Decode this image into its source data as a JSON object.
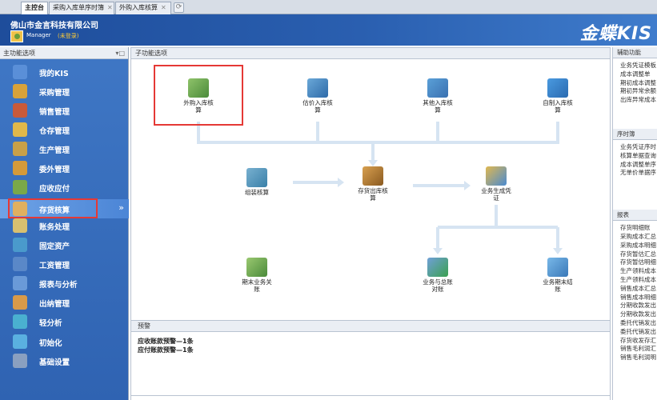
{
  "tabs": [
    {
      "label": "主控台",
      "closable": false,
      "active": true
    },
    {
      "label": "采购入库单序时簿",
      "closable": true,
      "active": false
    },
    {
      "label": "外购入库核算",
      "closable": true,
      "active": false
    }
  ],
  "tab_add_icon": "⟳",
  "header": {
    "company": "佛山市金言科技有限公司",
    "user": "Manager",
    "user_status": "(未登录)",
    "brand": "金蝶KIS"
  },
  "sidebar": {
    "title": "主功能选项",
    "pin": "▾□",
    "items": [
      {
        "label": "我的KIS",
        "icon": "my-kis-icon",
        "color": "#5a8fd8"
      },
      {
        "label": "采购管理",
        "icon": "purchase-icon",
        "color": "#d8a23a"
      },
      {
        "label": "销售管理",
        "icon": "sales-icon",
        "color": "#c85a3a"
      },
      {
        "label": "仓存管理",
        "icon": "warehouse-icon",
        "color": "#e0b84a"
      },
      {
        "label": "生产管理",
        "icon": "production-icon",
        "color": "#c8a048"
      },
      {
        "label": "委外管理",
        "icon": "outsource-icon",
        "color": "#d49a3a"
      },
      {
        "label": "应收应付",
        "icon": "receivable-icon",
        "color": "#7aa848"
      },
      {
        "label": "存货核算",
        "icon": "inventory-icon",
        "color": "#e0b060"
      },
      {
        "label": "账务处理",
        "icon": "accounting-icon",
        "color": "#d8c070"
      },
      {
        "label": "固定资产",
        "icon": "asset-icon",
        "color": "#4a9acc"
      },
      {
        "label": "工资管理",
        "icon": "salary-icon",
        "color": "#5a88c8"
      },
      {
        "label": "报表与分析",
        "icon": "report-icon",
        "color": "#6a9ad8"
      },
      {
        "label": "出纳管理",
        "icon": "cashier-icon",
        "color": "#d89a4a"
      },
      {
        "label": "轻分析",
        "icon": "analysis-icon",
        "color": "#4ab0d0"
      },
      {
        "label": "初始化",
        "icon": "init-icon",
        "color": "#5ab0e0"
      },
      {
        "label": "基础设置",
        "icon": "settings-icon",
        "color": "#8aa0c0"
      }
    ],
    "selected_index": 7,
    "selected_arrow": "»"
  },
  "main": {
    "title": "子功能选项",
    "nodes": [
      {
        "id": "purchase-in",
        "label": "外购入库核\n算"
      },
      {
        "id": "estimate-in",
        "label": "估价入库核\n算"
      },
      {
        "id": "other-in",
        "label": "其他入库核\n算"
      },
      {
        "id": "self-made-in",
        "label": "自制入库核\n算"
      },
      {
        "id": "assembly",
        "label": "组装核算"
      },
      {
        "id": "outbound",
        "label": "存货出库核\n算"
      },
      {
        "id": "gen-voucher",
        "label": "业务生成凭\n证"
      },
      {
        "id": "period-end",
        "label": "期末业务关\n账"
      },
      {
        "id": "reconcile",
        "label": "业务与总账\n对账"
      },
      {
        "id": "period-close",
        "label": "业务期末结\n账"
      }
    ]
  },
  "alerts": {
    "title": "预警",
    "lines": [
      "应收账款预警—1条",
      "应付账款预警—1条"
    ]
  },
  "right_panel": {
    "sections": [
      {
        "title": "辅助功能",
        "items": [
          "业务凭证模板",
          "成本调整单",
          "期初成本调整",
          "期初异常余额",
          "出库异常成本"
        ]
      },
      {
        "title": "序时簿",
        "items": [
          "业务凭证序时",
          "核算单据查询",
          "成本调整单序",
          "无单价单据序"
        ]
      },
      {
        "title": "报表",
        "items": [
          "存货明细账",
          "采购成本汇总",
          "采购成本明细",
          "存货暂估汇总",
          "存货暂估明细",
          "生产领料成本",
          "生产领料成本",
          "销售成本汇总",
          "销售成本明细",
          "分期收款发出",
          "分期收款发出",
          "委托代销发出",
          "委托代销发出",
          "存货收发存汇",
          "销售毛利润汇",
          "销售毛利润明"
        ]
      }
    ]
  }
}
